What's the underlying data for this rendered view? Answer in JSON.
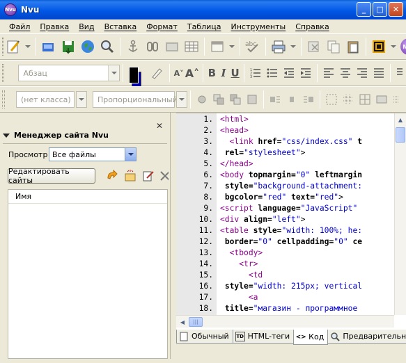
{
  "window": {
    "title": "Nvu",
    "logo_text": "Nvu"
  },
  "menu": [
    "Файл",
    "Правка",
    "Вид",
    "Вставка",
    "Формат",
    "Таблица",
    "Инструменты",
    "Справка"
  ],
  "format_toolbar": {
    "paragraph_style": "Абзац"
  },
  "style_toolbar": {
    "class_value": "(нет класса)",
    "font_value": "Пропорциональный"
  },
  "site_manager": {
    "title": "Менеджер сайта Nvu",
    "view_label": "Просмотр",
    "view_value": "Все файлы",
    "edit_sites_label": "Редактировать сайты",
    "column_name": "Имя",
    "close_glyph": "✕"
  },
  "editor": {
    "lines": [
      {
        "n": "1.",
        "html": "<span class='tag'>&lt;html&gt;</span>"
      },
      {
        "n": "2.",
        "html": "<span class='tag'>&lt;head&gt;</span>"
      },
      {
        "n": "3.",
        "html": "  <span class='tag'>&lt;link</span> <span class='attr'>href=</span><span class='val'>\"css/index.css\"</span> <span class='attr'>t</span>"
      },
      {
        "n": "4.",
        "html": " <span class='attr'>rel=</span><span class='val'>\"stylesheet\"</span>&gt;"
      },
      {
        "n": "5.",
        "html": "<span class='tag'>&lt;/head&gt;</span>"
      },
      {
        "n": "6.",
        "html": "<span class='tag'>&lt;body</span> <span class='attr'>topmargin=</span><span class='val'>\"0\"</span> <span class='attr'>leftmargin</span>"
      },
      {
        "n": "7.",
        "html": " <span class='attr'>style=</span><span class='val'>\"background-attachment:</span>"
      },
      {
        "n": "8.",
        "html": " <span class='attr'>bgcolor=</span><span class='val'>\"red\"</span> <span class='attr'>text=</span><span class='val'>\"red\"</span>&gt;"
      },
      {
        "n": "9.",
        "html": "<span class='tag'>&lt;script</span> <span class='attr'>language=</span><span class='val'>\"JavaScript\"</span>"
      },
      {
        "n": "10.",
        "html": "<span class='tag'>&lt;div</span> <span class='attr'>align=</span><span class='val'>\"left\"</span>&gt;"
      },
      {
        "n": "11.",
        "html": "<span class='tag'>&lt;table</span> <span class='attr'>style=</span><span class='val'>\"width: 100%; he:</span>"
      },
      {
        "n": "12.",
        "html": " <span class='attr'>border=</span><span class='val'>\"0\"</span> <span class='attr'>cellpadding=</span><span class='val'>\"0\"</span> <span class='attr'>ce</span>"
      },
      {
        "n": "13.",
        "html": "  <span class='tag'>&lt;tbody&gt;</span>"
      },
      {
        "n": "14.",
        "html": "    <span class='tag'>&lt;tr&gt;</span>"
      },
      {
        "n": "15.",
        "html": "      <span class='tag'>&lt;td</span>"
      },
      {
        "n": "16.",
        "html": " <span class='attr'>style=</span><span class='val'>\"width: 215px; vertical</span>"
      },
      {
        "n": "17.",
        "html": "      <span class='tag'>&lt;a</span>"
      },
      {
        "n": "18.",
        "html": " <span class='attr'>title=</span><span class='val'>\"магазин - программное</span>"
      }
    ]
  },
  "tabs": [
    {
      "label": "Обычный",
      "icon": "page-icon"
    },
    {
      "label": "HTML-теги",
      "icon": "td-icon"
    },
    {
      "label": "Код",
      "icon": "code-icon",
      "active": true
    },
    {
      "label": "Предварительный",
      "icon": "preview-icon"
    }
  ],
  "colors": {
    "title_blue": "#0058e6",
    "tag": "#8b008b",
    "value": "#0000cc",
    "foreground_color": "#000000",
    "background_color": "#0000a0"
  }
}
